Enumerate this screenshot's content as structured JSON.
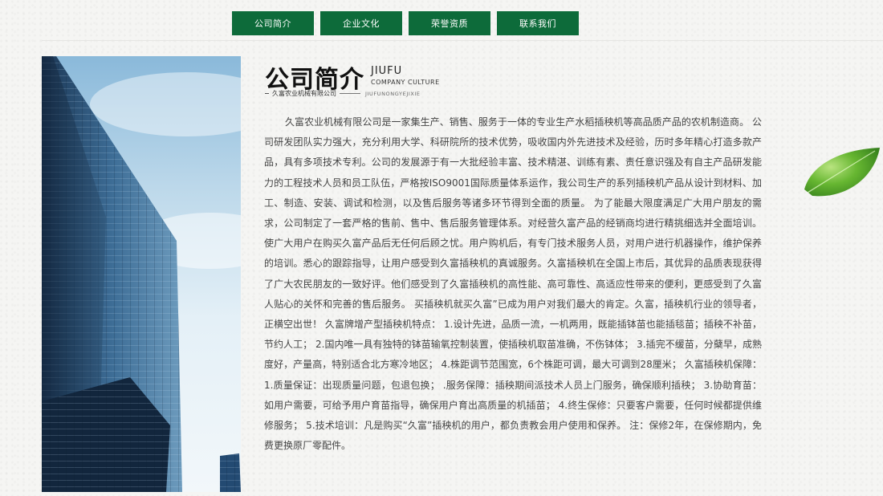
{
  "nav": {
    "items": [
      {
        "label": "公司简介"
      },
      {
        "label": "企业文化"
      },
      {
        "label": "荣誉资质"
      },
      {
        "label": "联系我们"
      }
    ]
  },
  "section": {
    "title_cn": "公司简介",
    "title_en": "JIUFU",
    "subtitle_en": "COMPANY CULTURE",
    "company_name": "久富农业机械有限公司",
    "company_pinyin": "JIUFUNONGYEJIXIE"
  },
  "body_text": "久富农业机械有限公司是一家集生产、销售、服务于一体的专业生产水稻插秧机等高品质产品的农机制造商。 公司研发团队实力强大，充分利用大学、科研院所的技术优势，吸收国内外先进技术及经验，历时多年精心打造多款产品，具有多项技术专利。公司的发展源于有一大批经验丰富、技术精湛、训练有素、责任意识强及有自主产品研发能力的工程技术人员和员工队伍，严格按ISO9001国际质量体系运作，我公司生产的系列插秧机产品从设计到材料、加工、制造、安装、调试和检测，以及售后服务等诸多环节得到全面的质量。 为了能最大限度满足广大用户朋友的需求，公司制定了一套严格的售前、售中、售后服务管理体系。对经营久富产品的经销商均进行精挑细选并全面培训。使广大用户在购买久富产品后无任何后顾之忧。用户购机后，有专门技术服务人员，对用户进行机器操作，维护保养的培训。悉心的跟踪指导，让用户感受到久富插秧机的真诚服务。久富插秧机在全国上市后，其优异的品质表现获得了广大农民朋友的一致好评。他们感受到了久富插秧机的高性能、高可靠性、高适应性带来的便利，更感受到了久富人贴心的关怀和完善的售后服务。 买插秧机就买久富”已成为用户对我们最大的肯定。久富，插秧机行业的领导者，正横空出世！ 久富牌增产型插秧机特点： 1.设计先进，品质一流，一机两用，既能插钵苗也能插毯苗；插秧不补苗，节约人工； 2.国内唯一具有独特的钵苗输氧控制装置，使插秧机取苗准确，不伤钵体； 3.插完不缓苗，分蘖早，成熟度好，产量高，特别适合北方寒冷地区； 4.株距调节范围宽，6个株距可调，最大可调到28厘米； 久富插秧机保障：1.质量保证：出现质量问题，包退包换； .服务保障：插秧期间派技术人员上门服务，确保顺利插秧； 3.协助育苗：如用户需要，可给予用户育苗指导，确保用户育出高质量的机插苗； 4.终生保修：只要客户需要，任何时候都提供维修服务； 5.技术培训：凡是购买“久富”插秧机的用户，都负责教会用户使用和保养。 注：保修2年，在保修期内，免费更换原厂零配件。",
  "colors": {
    "nav_bg": "#0d6b3a",
    "text": "#444444",
    "leaf": "#4caf1e"
  },
  "images": {
    "photo": "skyscraper-photo",
    "leaf": "green-leaf-decoration"
  }
}
